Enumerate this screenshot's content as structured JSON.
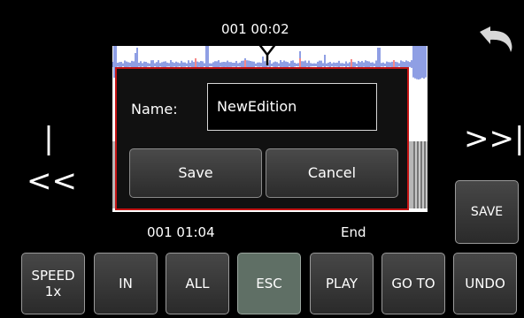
{
  "header": {
    "position_timecode": "001 00:02"
  },
  "nav": {
    "prev_label": "|<<",
    "next_label": ">>|"
  },
  "dialog": {
    "name_label": "Name:",
    "name_value": "NewEdition",
    "save_label": "Save",
    "cancel_label": "Cancel"
  },
  "footer_info": {
    "in_timecode": "001 01:04",
    "end_label": "End"
  },
  "save_button_label": "SAVE",
  "toolbar": {
    "speed_line1": "SPEED",
    "speed_line2": "1x",
    "in_label": "IN",
    "all_label": "ALL",
    "esc_label": "ESC",
    "play_label": "PLAY",
    "goto_label": "GO TO",
    "undo_label": "UNDO",
    "active": "ESC"
  },
  "icons": {
    "undo": "undo-arrow-icon",
    "playhead": "playhead-marker-icon"
  },
  "colors": {
    "dialog_border": "#c41313",
    "waveform": "#1f3fc8",
    "active_button": "#5f6f65"
  }
}
